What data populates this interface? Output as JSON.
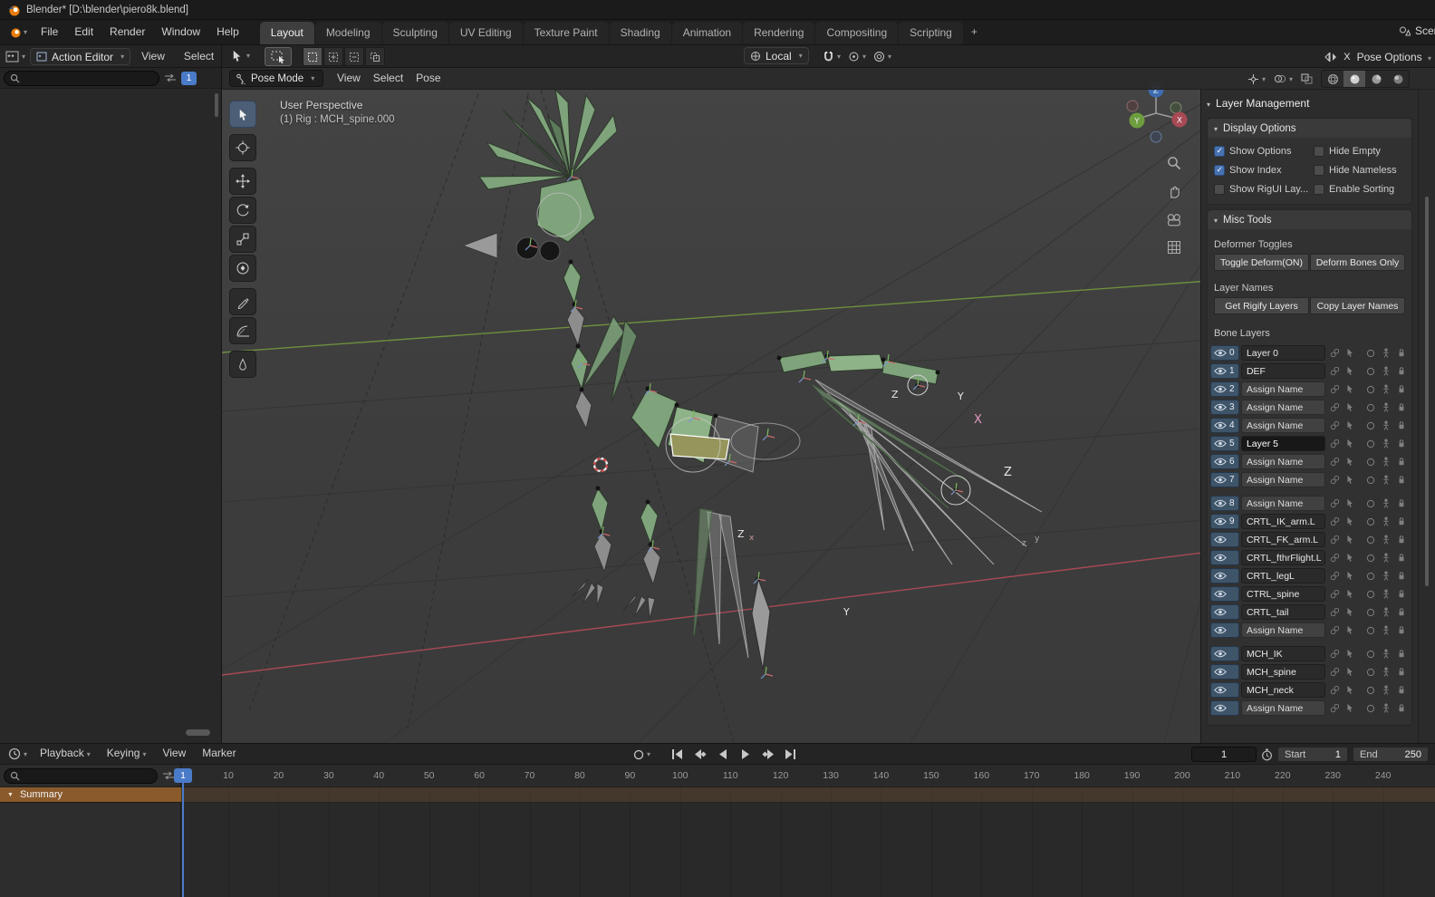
{
  "title_bar": {
    "app_title": "Blender* [D:\\blender\\piero8k.blend]"
  },
  "menu_bar": {
    "menus": [
      "File",
      "Edit",
      "Render",
      "Window",
      "Help"
    ],
    "tabs": [
      {
        "label": "Layout",
        "cls": "active"
      },
      {
        "label": "Modeling"
      },
      {
        "label": "Sculpting"
      },
      {
        "label": "UV Editing"
      },
      {
        "label": "Texture Paint"
      },
      {
        "label": "Shading"
      },
      {
        "label": "Animation"
      },
      {
        "label": "Rendering"
      },
      {
        "label": "Compositing"
      },
      {
        "label": "Scripting"
      }
    ],
    "add_tab_label": "+",
    "scene_selector": "Scene"
  },
  "tool_settings": {
    "editor_dropdown": "Action Editor",
    "editor_menus": [
      "View",
      "Select"
    ],
    "orientation": "Local",
    "mirror_label": "X",
    "pose_options_label": "Pose Options"
  },
  "viewport": {
    "mode": "Pose Mode",
    "menus": [
      "View",
      "Select",
      "Pose"
    ],
    "overlay_line1": "User Perspective",
    "overlay_line2": "(1) Rig : MCH_spine.000",
    "letters": [
      "Y",
      "Z",
      "X",
      "Z",
      "Y",
      "Z",
      "x",
      "z",
      "y"
    ],
    "gizmo": {
      "x": "X",
      "y": "Y",
      "z": "Z"
    }
  },
  "n_panel": {
    "title": "Layer Management",
    "display_options_title": "Display Options",
    "misc_tools_title": "Misc Tools",
    "checkboxes": [
      {
        "label": "Show Options",
        "cls": "checked"
      },
      {
        "label": "Hide Empty"
      },
      {
        "label": "Show Index",
        "cls": "checked"
      },
      {
        "label": "Hide Nameless"
      },
      {
        "label": "Show RigUI Lay..."
      },
      {
        "label": "Enable Sorting"
      }
    ],
    "deformer_toggles_label": "Deformer Toggles",
    "deformer_buttons": [
      "Toggle Deform(ON)",
      "Deform Bones Only"
    ],
    "layer_names_label": "Layer Names",
    "layer_names_buttons": [
      "Get Rigify Layers",
      "Copy Layer Names"
    ],
    "bone_layers_label": "Bone Layers",
    "bone_layers": [
      {
        "num": "0",
        "name": "Layer 0",
        "name_class": "named"
      },
      {
        "num": "1",
        "name": "DEF",
        "name_class": "named"
      },
      {
        "num": "2",
        "name": "Assign Name",
        "name_class": "assign"
      },
      {
        "num": "3",
        "name": "Assign Name",
        "name_class": "assign"
      },
      {
        "num": "4",
        "name": "Assign Name",
        "name_class": "assign"
      },
      {
        "num": "5",
        "name": "Layer 5",
        "name_class": "named selected"
      },
      {
        "num": "6",
        "name": "Assign Name",
        "name_class": "assign"
      },
      {
        "num": "7",
        "name": "Assign Name",
        "name_class": "assign"
      },
      {
        "num": "8",
        "name": "Assign Name",
        "name_class": "assign",
        "row_class": "gap"
      },
      {
        "num": "9",
        "name": "CRTL_IK_arm.L",
        "name_class": "named"
      },
      {
        "name": "CRTL_FK_arm.L",
        "name_class": "named"
      },
      {
        "name": "CRTL_fthrFlight.L",
        "name_class": "named"
      },
      {
        "name": "CRTL_legL",
        "name_class": "named"
      },
      {
        "name": "CTRL_spine",
        "name_class": "named"
      },
      {
        "name": "CRTL_tail",
        "name_class": "named"
      },
      {
        "name": "Assign Name",
        "name_class": "assign"
      },
      {
        "name": "MCH_IK",
        "name_class": "named",
        "row_class": "gap"
      },
      {
        "name": "MCH_spine",
        "name_class": "named"
      },
      {
        "name": "MCH_neck",
        "name_class": "named"
      },
      {
        "name": "Assign Name",
        "name_class": "assign"
      }
    ]
  },
  "timeline": {
    "menus": [
      {
        "label": "Playback",
        "cls": "caret"
      },
      {
        "label": "Keying",
        "cls": "caret"
      },
      {
        "label": "View"
      },
      {
        "label": "Marker"
      }
    ],
    "current_frame": "1",
    "frame_badge": "1",
    "start_label": "Start",
    "start_value": "1",
    "end_label": "End",
    "end_value": "250",
    "ruler": [
      "10",
      "20",
      "30",
      "40",
      "50",
      "60",
      "70",
      "80",
      "90",
      "100",
      "110",
      "120",
      "130",
      "140",
      "150",
      "160",
      "170",
      "180",
      "190",
      "200",
      "210",
      "220",
      "230",
      "240"
    ],
    "summary_label": "Summary"
  },
  "dopesheet": {
    "frame_badge": "1"
  },
  "colors": {
    "accent_blue": "#4a7bc8",
    "checkbox_blue": "#4772b3",
    "summary_orange": "#8a5a2b",
    "axis_red": "#a84a55",
    "axis_green": "#6d8f3e",
    "bone_green": "#7fa37b"
  },
  "icons": {
    "caret-down": "▾",
    "collapse-triangle": "▼",
    "checkmark": "✓",
    "search": "svg-magnifier",
    "swap": "svg-arrows",
    "eye": "svg-eye",
    "lock": "svg-lock"
  }
}
